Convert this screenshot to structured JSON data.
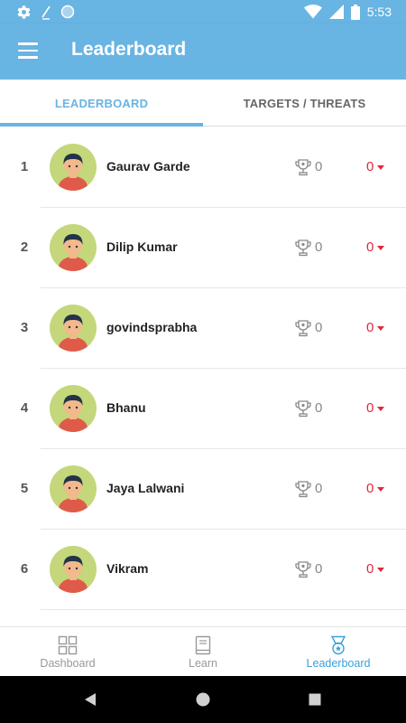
{
  "status_bar": {
    "time": "5:53",
    "icons": [
      "gear-icon",
      "signal-scan-icon",
      "circle-icon",
      "wifi-icon",
      "cell-signal-icon",
      "battery-icon"
    ]
  },
  "app_bar": {
    "title": "Leaderboard",
    "menu_icon": "hamburger-menu-icon",
    "color": "#68b4e2"
  },
  "tabs": [
    {
      "label": "LEADERBOARD",
      "active": true
    },
    {
      "label": "TARGETS / THREATS",
      "active": false
    }
  ],
  "leaderboard": {
    "rows": [
      {
        "rank": "1",
        "name": "Gaurav Garde",
        "points": "0",
        "change": "0"
      },
      {
        "rank": "2",
        "name": "Dilip Kumar",
        "points": "0",
        "change": "0"
      },
      {
        "rank": "3",
        "name": "govindsprabha",
        "points": "0",
        "change": "0"
      },
      {
        "rank": "4",
        "name": "Bhanu",
        "points": "0",
        "change": "0"
      },
      {
        "rank": "5",
        "name": "Jaya Lalwani",
        "points": "0",
        "change": "0"
      },
      {
        "rank": "6",
        "name": "Vikram",
        "points": "0",
        "change": "0"
      }
    ],
    "change_color": "#e0283a",
    "trophy_icon": "trophy-icon",
    "change_icon": "caret-down-icon"
  },
  "bottom_nav": {
    "items": [
      {
        "label": "Dashboard",
        "icon": "dashboard-grid-icon",
        "active": false
      },
      {
        "label": "Learn",
        "icon": "book-icon",
        "active": false
      },
      {
        "label": "Leaderboard",
        "icon": "medal-icon",
        "active": true
      }
    ],
    "active_color": "#3aa0d8"
  },
  "system_nav": {
    "icons": [
      "back-icon",
      "home-icon",
      "recents-icon"
    ]
  }
}
